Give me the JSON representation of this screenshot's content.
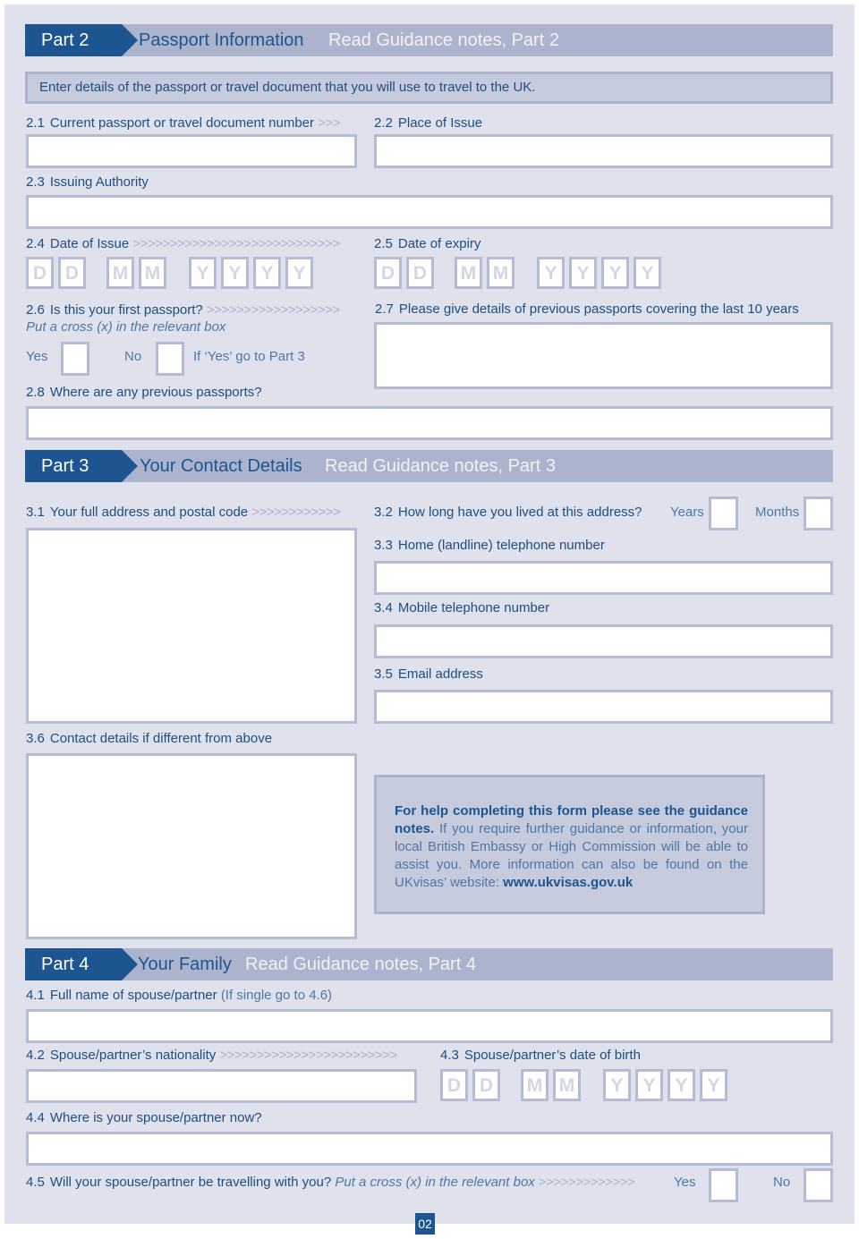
{
  "part2": {
    "tag": "Part 2",
    "title": "Passport Information",
    "guidance": "Read Guidance notes, Part 2",
    "notice": "Enter details of the passport or travel document that you will use to travel to the UK.",
    "q2_1": {
      "num": "2.1",
      "label": "Current passport or travel document number",
      "arrows": ">>>"
    },
    "q2_2": {
      "num": "2.2",
      "label": "Place of Issue"
    },
    "q2_3": {
      "num": "2.3",
      "label": "Issuing Authority"
    },
    "q2_4": {
      "num": "2.4",
      "label": "Date of Issue",
      "arrows": ">>>>>>>>>>>>>>>>>>>>>>>>>>>>"
    },
    "q2_5": {
      "num": "2.5",
      "label": "Date of expiry"
    },
    "q2_6": {
      "num": "2.6",
      "label": "Is this your first passport?",
      "arrows": ">>>>>>>>>>>>>>>>>>",
      "instruction": "Put a cross (x) in the relevant box",
      "yes": "Yes",
      "no": "No",
      "note": "If ‘Yes’ go to Part 3"
    },
    "q2_7": {
      "num": "2.7",
      "label": "Please give details of previous passports covering the last 10 years"
    },
    "q2_8": {
      "num": "2.8",
      "label": "Where are any previous passports?"
    }
  },
  "date_placeholders": [
    "D",
    "D",
    "M",
    "M",
    "Y",
    "Y",
    "Y",
    "Y"
  ],
  "part3": {
    "tag": "Part 3",
    "title": "Your Contact Details",
    "guidance": "Read Guidance notes, Part 3",
    "q3_1": {
      "num": "3.1",
      "label": "Your full address and postal code",
      "arrows": ">>>>>>>>>>>>"
    },
    "q3_2": {
      "num": "3.2",
      "label": "How long have you lived at this address?",
      "years": "Years",
      "months": "Months"
    },
    "q3_3": {
      "num": "3.3",
      "label": "Home (landline) telephone number"
    },
    "q3_4": {
      "num": "3.4",
      "label": "Mobile telephone number"
    },
    "q3_5": {
      "num": "3.5",
      "label": "Email address"
    },
    "q3_6": {
      "num": "3.6",
      "label": "Contact details if different from above"
    }
  },
  "help": {
    "bold_intro": "For help completing this form please see the guidance notes.",
    "body": " If you require further guidance or information, your local British Embassy or High Commission will be able to assist you. More information can also be found on the UKvisas’ website: ",
    "link": "www.ukvisas.gov.uk"
  },
  "part4": {
    "tag": "Part 4",
    "title": "Your Family",
    "guidance": "Read Guidance notes, Part 4",
    "q4_1": {
      "num": "4.1",
      "label": "Full name of spouse/partner",
      "note": "(If single go to 4.6)"
    },
    "q4_2": {
      "num": "4.2",
      "label": "Spouse/partner’s nationality",
      "arrows": ">>>>>>>>>>>>>>>>>>>>>>>>"
    },
    "q4_3": {
      "num": "4.3",
      "label": "Spouse/partner’s date of birth"
    },
    "q4_4": {
      "num": "4.4",
      "label": "Where is your spouse/partner now?"
    },
    "q4_5": {
      "num": "4.5",
      "label": "Will your spouse/partner be travelling with you?",
      "instruction": "Put a cross (x) in the relevant box",
      "arrows": ">>>>>>>>>>>>>",
      "yes": "Yes",
      "no": "No"
    }
  },
  "page_number": "02",
  "colors": {
    "brand_blue": "#1d5591",
    "panel": "#dfe2ec",
    "bar": "#abb3cd",
    "field_border": "#b4bbd2"
  }
}
